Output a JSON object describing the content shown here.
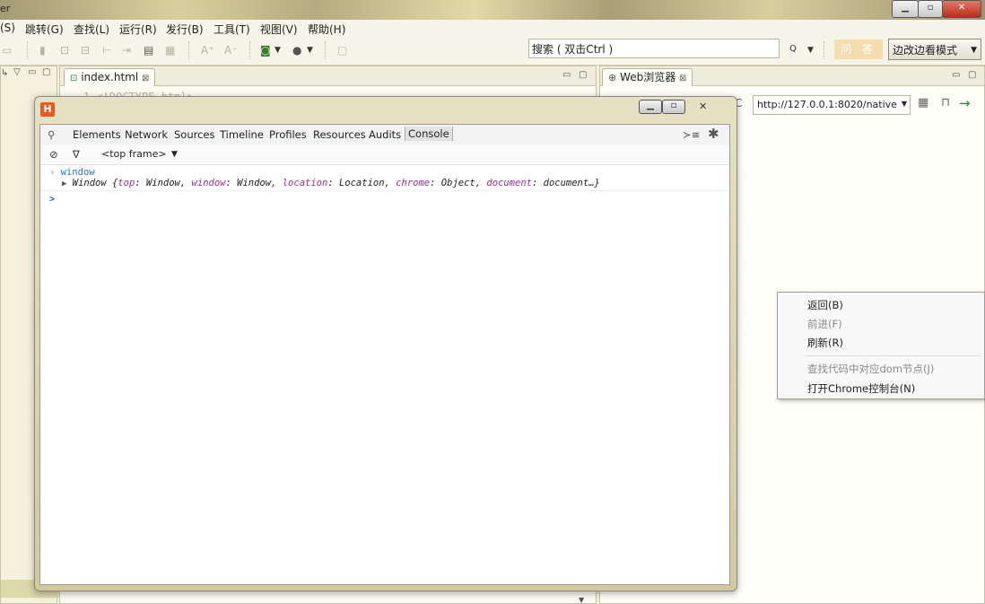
{
  "window": {
    "title_fragment": "er",
    "minimize_glyph": "▁",
    "restore_glyph": "▫",
    "close_glyph": "✕"
  },
  "menubar": {
    "items": [
      "(S)",
      "跳转(G)",
      "查找(L)",
      "运行(R)",
      "发行(B)",
      "工具(T)",
      "视图(V)",
      "帮助(H)"
    ]
  },
  "toolbar": {
    "search_placeholder": "搜索 ( 双击Ctrl )",
    "search_icon": "Q",
    "ask_label": "问 答",
    "mode_label": "边改边看模式"
  },
  "editor": {
    "tab_label": "index.html",
    "code_line_fragment": "1  <!DOCTYPE html>"
  },
  "browser": {
    "tab_label": "Web浏览器",
    "url": "http://127.0.0.1:8020/native"
  },
  "devtools": {
    "tabs": [
      "Elements",
      "Network",
      "Sources",
      "Timeline",
      "Profiles",
      "Resources",
      "Audits",
      "Console"
    ],
    "active_tab": "Console",
    "frame_selector": "<top frame>",
    "console": {
      "input_line": "window",
      "output_prefix": "Window {",
      "output_props": [
        {
          "key": "top",
          "value": "Window"
        },
        {
          "key": "window",
          "value": "Window"
        },
        {
          "key": "location",
          "value": "Location"
        },
        {
          "key": "chrome",
          "value": "Object"
        },
        {
          "key": "document",
          "value": "document…}"
        }
      ],
      "prompt": ">"
    }
  },
  "context_menu": {
    "items": [
      {
        "label": "返回(B)",
        "enabled": true
      },
      {
        "label": "前进(F)",
        "enabled": false
      },
      {
        "label": "刷新(R)",
        "enabled": true
      },
      {
        "label": "查找代码中对应dom节点(J)",
        "enabled": false
      },
      {
        "label": "打开Chrome控制台(N)",
        "enabled": true
      }
    ]
  },
  "colors": {
    "accent_orange": "#e85a21",
    "console_blue": "#2a6fd6",
    "prop_purple": "#a02aa0",
    "disabled_text": "#8a8a8a"
  }
}
